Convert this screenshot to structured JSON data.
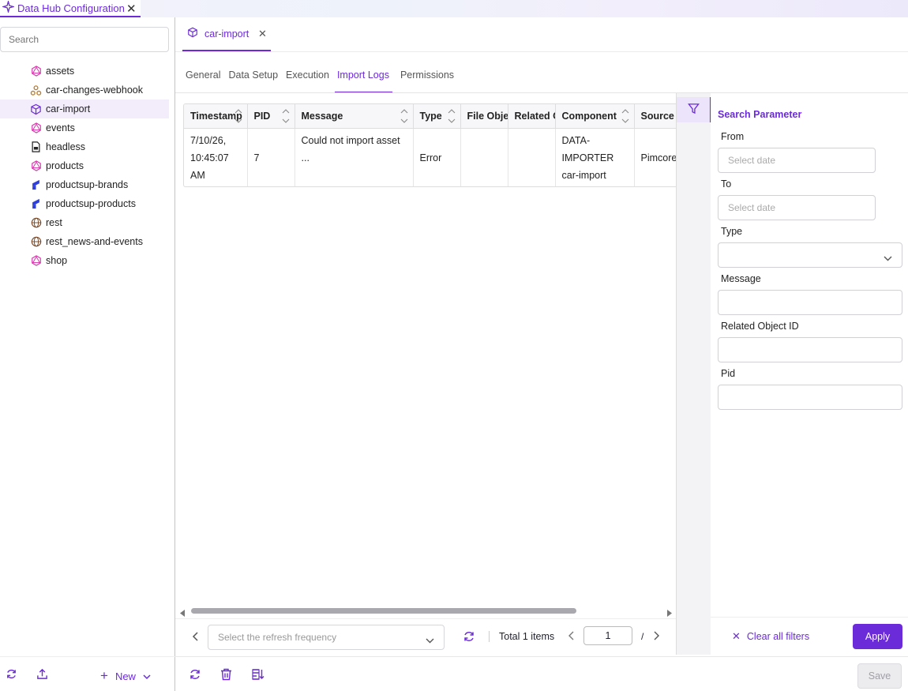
{
  "app": {
    "title": "Data Hub Configuration"
  },
  "sidebar": {
    "search_placeholder": "Search",
    "items": [
      {
        "label": "assets",
        "icon": "graphql-icon"
      },
      {
        "label": "car-changes-webhook",
        "icon": "webhook-icon"
      },
      {
        "label": "car-import",
        "icon": "import-icon",
        "active": true
      },
      {
        "label": "events",
        "icon": "graphql-icon"
      },
      {
        "label": "headless",
        "icon": "document-icon"
      },
      {
        "label": "products",
        "icon": "graphql-icon"
      },
      {
        "label": "productsup-brands",
        "icon": "productsup-icon"
      },
      {
        "label": "productsup-products",
        "icon": "productsup-icon"
      },
      {
        "label": "rest",
        "icon": "globe-icon"
      },
      {
        "label": "rest_news-and-events",
        "icon": "globe-icon"
      },
      {
        "label": "shop",
        "icon": "graphql-icon"
      }
    ],
    "footer": {
      "new_label": "New"
    }
  },
  "doc_tab": {
    "label": "car-import"
  },
  "subtabs": [
    "General",
    "Data Setup",
    "Execution",
    "Import Logs",
    "Permissions"
  ],
  "active_subtab": "Import Logs",
  "table": {
    "columns": [
      "Timestamp",
      "PID",
      "Message",
      "Type",
      "File Objec",
      "Related C",
      "Component",
      "Source"
    ],
    "rows": [
      {
        "timestamp": "7/10/26, 10:45:07 AM",
        "pid": "7",
        "message": "Could not import asset ...",
        "type": "Error",
        "file_object": "",
        "related": "",
        "component": "DATA-IMPORTER car-import",
        "source": "PimcoreV"
      }
    ]
  },
  "pager": {
    "refresh_placeholder": "Select the refresh frequency",
    "total": "Total 1 items",
    "page": "1",
    "separator": "/"
  },
  "filter": {
    "title": "Search Parameter",
    "from_label": "From",
    "from_placeholder": "Select date",
    "to_label": "To",
    "to_placeholder": "Select date",
    "type_label": "Type",
    "message_label": "Message",
    "related_label": "Related Object ID",
    "pid_label": "Pid",
    "clear_label": "Clear all filters",
    "apply_label": "Apply"
  },
  "footer": {
    "save_label": "Save"
  },
  "colors": {
    "accent": "#6c2bd9"
  }
}
